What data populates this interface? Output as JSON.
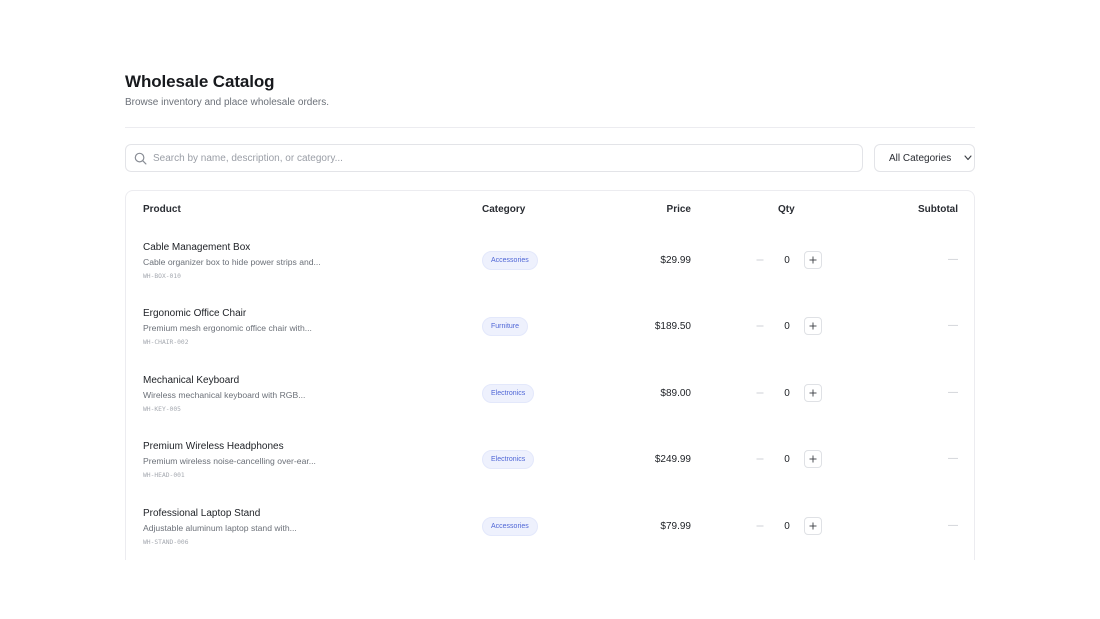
{
  "header": {
    "title": "Wholesale Catalog",
    "subtitle": "Browse inventory and place wholesale orders."
  },
  "search": {
    "placeholder": "Search by name, description, or category...",
    "value": ""
  },
  "filter": {
    "selected": "All Categories"
  },
  "table": {
    "columns": [
      "Product",
      "Category",
      "Price",
      "Qty",
      "Subtotal"
    ],
    "rows": [
      {
        "name": "Cable Management Box",
        "description": "Cable organizer box to hide power strips and...",
        "sku": "WH-BOX-010",
        "category": "Accessories",
        "price": "$29.99",
        "qty": "0",
        "subtotal": "—"
      },
      {
        "name": "Ergonomic Office Chair",
        "description": "Premium mesh ergonomic office chair with...",
        "sku": "WH-CHAIR-002",
        "category": "Furniture",
        "price": "$189.50",
        "qty": "0",
        "subtotal": "—"
      },
      {
        "name": "Mechanical Keyboard",
        "description": "Wireless mechanical keyboard with RGB...",
        "sku": "WH-KEY-005",
        "category": "Electronics",
        "price": "$89.00",
        "qty": "0",
        "subtotal": "—"
      },
      {
        "name": "Premium Wireless Headphones",
        "description": "Premium wireless noise-cancelling over-ear...",
        "sku": "WH-HEAD-001",
        "category": "Electronics",
        "price": "$249.99",
        "qty": "0",
        "subtotal": "—"
      },
      {
        "name": "Professional Laptop Stand",
        "description": "Adjustable aluminum laptop stand with...",
        "sku": "WH-STAND-006",
        "category": "Accessories",
        "price": "$79.99",
        "qty": "0",
        "subtotal": "—"
      }
    ]
  },
  "icons": {
    "search": "search-icon",
    "dropdown": "chevron-down-icon",
    "decrement": "minus-icon",
    "increment": "plus-icon"
  },
  "colors": {
    "badge_text": "#4f66d6",
    "badge_bg": "#eef1fd",
    "border": "#e3e4e8"
  }
}
